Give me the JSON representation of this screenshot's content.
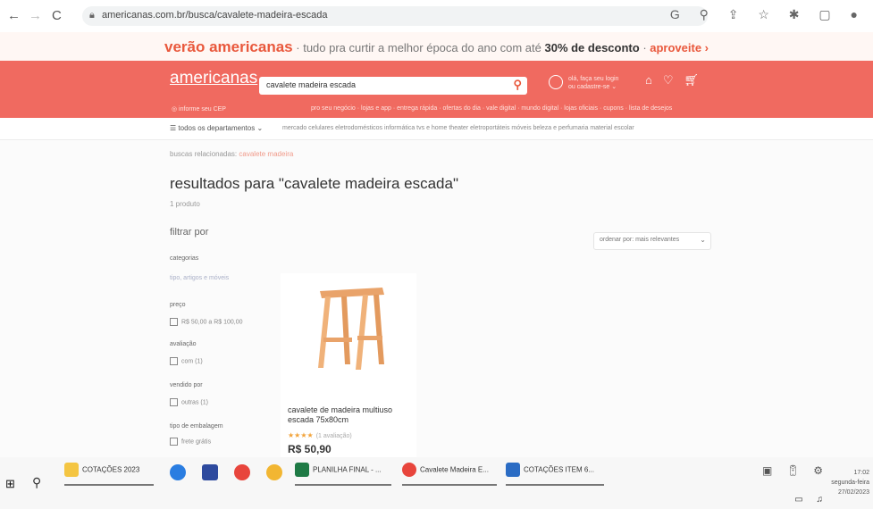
{
  "browser": {
    "url": "americanas.com.br/busca/cavalete-madeira-escada",
    "icons": [
      "back-icon",
      "forward-icon",
      "reload-icon",
      "google-icon",
      "zoom-icon",
      "share-icon",
      "star-icon",
      "extension-icon",
      "sidepanel-icon",
      "profile-icon"
    ]
  },
  "promo": {
    "title": "verão americanas",
    "text": "· tudo pra curtir a melhor época do ano com até",
    "bold": "30% de desconto",
    "cta": "aproveite ›"
  },
  "header": {
    "logo": "americanas",
    "search_value": "cavalete madeira escada",
    "user_line1": "olá, faça seu login",
    "user_line2": "ou cadastre-se ⌄",
    "cep": "◎ informe seu CEP",
    "sublinks": "pro seu negócio · lojas e app · entrega rápida · ofertas do dia · vale digital · mundo digital · lojas oficiais · cupons · lista de desejos",
    "accent": "#f06a60"
  },
  "departments": {
    "all_label": "☰  todos os departamentos  ⌄",
    "links": "mercado   celulares   eletrodomésticos   informática   tvs e home theater   eletroportáteis   móveis   beleza e perfumaria   material escolar"
  },
  "content": {
    "related_prefix": "buscas relacionadas:",
    "related_keyword": "cavalete madeira",
    "results_title": "resultados para \"cavalete madeira escada\"",
    "product_count": "1 produto",
    "filter_title": "filtrar por",
    "sort_label": "ordenar por: mais relevantes",
    "filters": {
      "categories_label": "categorias",
      "categories_value": "tipo, artigos e móveis",
      "price_label": "preço",
      "price_option": "R$ 50,00 a R$ 100,00",
      "rating_label": "avaliação",
      "rating_option": "com (1)",
      "sold_by_label": "vendido por",
      "sold_by_option": "outras (1)",
      "packaging_label": "tipo de embalagem",
      "packaging_option": "frete grátis"
    }
  },
  "product": {
    "name": "cavalete de madeira multiuso escada 75x80cm",
    "stars": "★★★★",
    "reviews": "(1 avaliação)",
    "price": "R$ 50,90"
  },
  "taskbar": {
    "items": [
      {
        "label": "COTAÇÕES 2023"
      },
      {
        "label": "PLANILHA FINAL - ..."
      },
      {
        "label": "Cavalete Madeira E..."
      },
      {
        "label": "COTAÇÕES ITEM 6..."
      }
    ],
    "time": "17:02",
    "day": "segunda-feira",
    "date": "27/02/2023"
  }
}
